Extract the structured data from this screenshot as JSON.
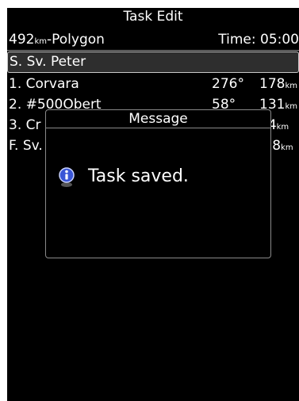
{
  "screen": {
    "title": "Task Edit"
  },
  "task": {
    "distance_value": "492",
    "distance_unit": "km",
    "type_suffix": "-Polygon",
    "time_label": "Time: 05:00"
  },
  "waypoints": [
    {
      "name": "S. Sv. Peter",
      "bearing": "",
      "distance": "",
      "unit": "",
      "selected": true
    },
    {
      "name": "1. Corvara",
      "bearing": "276°",
      "distance": "178",
      "unit": "km",
      "selected": false
    },
    {
      "name": "2. #500Obert",
      "bearing": "58°",
      "distance": "131",
      "unit": "km",
      "selected": false
    },
    {
      "name": "3. Cr",
      "bearing": "",
      "distance": "44",
      "unit": "km",
      "selected": false
    },
    {
      "name": "F. Sv.",
      "bearing": "",
      "distance": "3.8",
      "unit": "km",
      "selected": false
    }
  ],
  "dialog": {
    "title": "Message",
    "message": "Task saved.",
    "icon": "info-icon"
  }
}
